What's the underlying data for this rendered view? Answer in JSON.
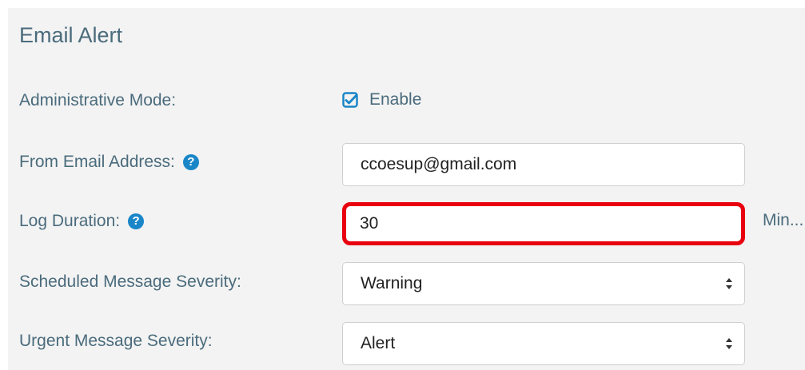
{
  "section": {
    "title": "Email Alert"
  },
  "admin_mode": {
    "label": "Administrative Mode:",
    "checkbox_label": "Enable",
    "checked": true
  },
  "from_email": {
    "label": "From Email Address:",
    "help_icon": "question-circle-icon",
    "value": "ccoesup@gmail.com"
  },
  "log_duration": {
    "label": "Log Duration:",
    "help_icon": "question-circle-icon",
    "value": "30",
    "unit": "Min..."
  },
  "scheduled_severity": {
    "label": "Scheduled Message Severity:",
    "selected": "Warning"
  },
  "urgent_severity": {
    "label": "Urgent Message Severity:",
    "selected": "Alert"
  },
  "colors": {
    "label_text": "#4a6b7c",
    "accent_blue": "#1a86c8",
    "highlight_red": "#e8000e",
    "panel_bg": "#f3f3f3"
  }
}
